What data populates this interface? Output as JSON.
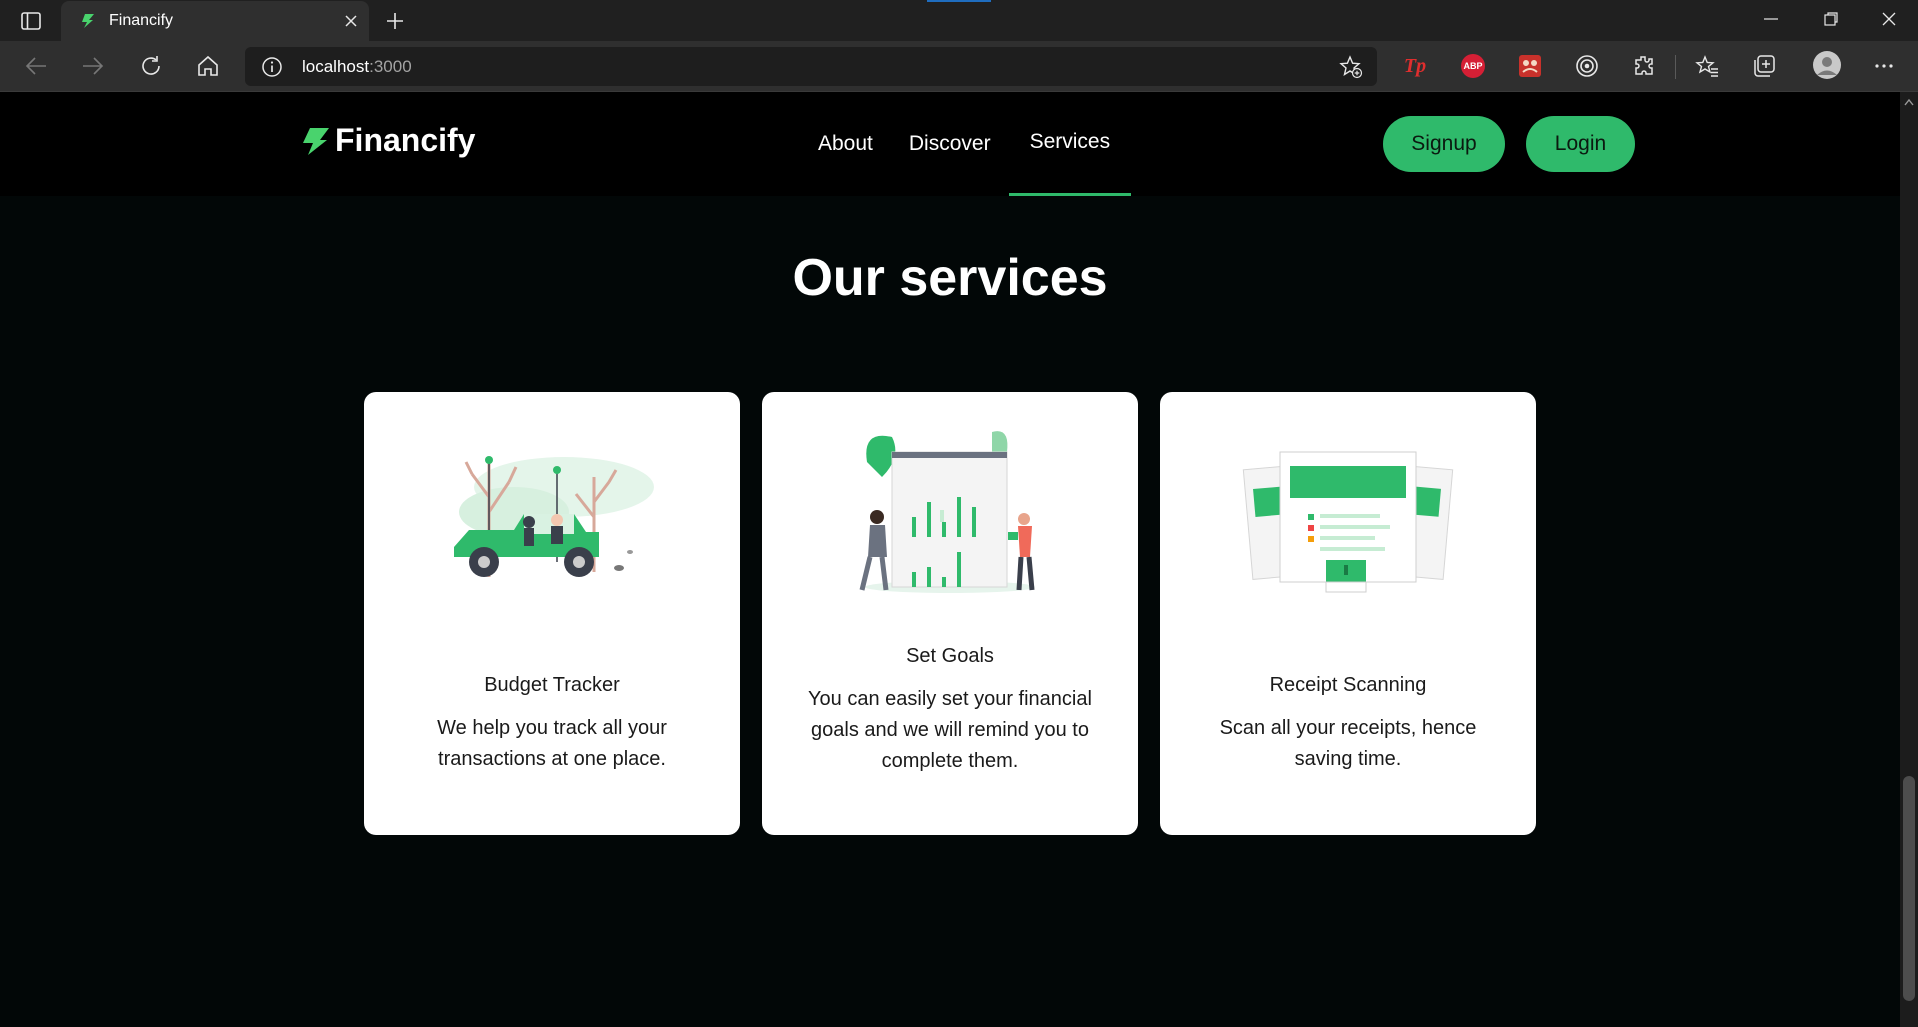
{
  "browser": {
    "tab_title": "Financify",
    "url_host": "localhost",
    "url_port": ":3000",
    "icons": [
      "tab-actions-icon",
      "favicon",
      "close-icon",
      "plus-icon",
      "minimize-icon",
      "restore-icon",
      "window-close-icon",
      "back-icon",
      "forward-icon",
      "reload-icon",
      "home-icon",
      "info-icon",
      "add-favorite-icon",
      "tp-extension-icon",
      "abp-extension-icon",
      "puzzle-extension-icon",
      "target-extension-icon",
      "extensions-icon",
      "favorites-icon",
      "collections-icon",
      "profile-icon",
      "more-icon"
    ],
    "extensions": {
      "tp": "Tp",
      "abp": "ABP"
    }
  },
  "site": {
    "brand": "Financify",
    "nav": {
      "about": "About",
      "discover": "Discover",
      "services": "Services"
    },
    "signup": "Signup",
    "login": "Login",
    "colors": {
      "accent": "#2fba6b",
      "background": "#020707",
      "navbar": "#000000"
    }
  },
  "services": {
    "heading": "Our services",
    "cards": [
      {
        "title": "Budget Tracker",
        "description": "We help you track all your transactions at one place."
      },
      {
        "title": "Set Goals",
        "description": "You can easily set your financial goals and we will remind you to complete them."
      },
      {
        "title": "Receipt Scanning",
        "description": "Scan all your receipts, hence saving time."
      }
    ]
  }
}
